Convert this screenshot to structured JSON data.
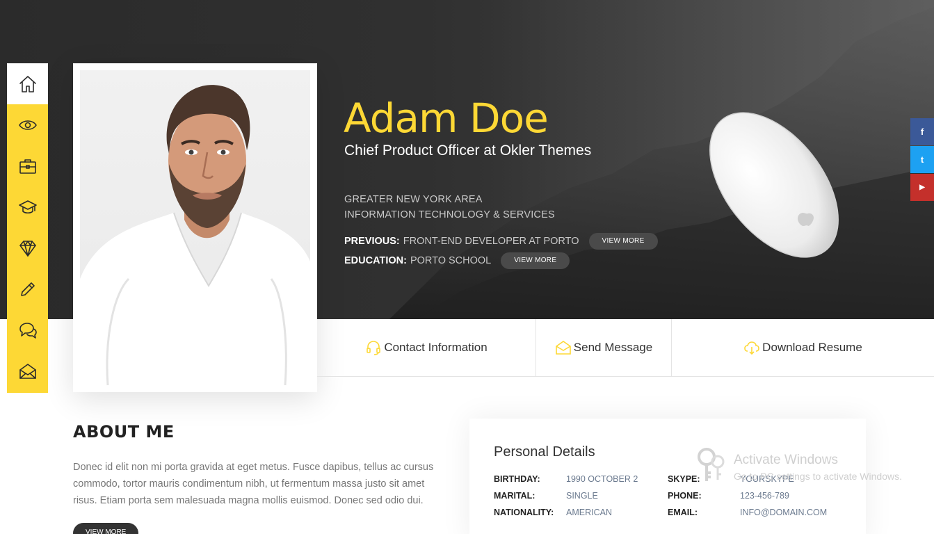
{
  "profile": {
    "name": "Adam Doe",
    "title": "Chief Product Officer at Okler Themes",
    "location": "GREATER NEW YORK AREA",
    "industry": "INFORMATION TECHNOLOGY & SERVICES",
    "previous_label": "PREVIOUS:",
    "previous_value": "FRONT-END DEVELOPER AT PORTO",
    "education_label": "EDUCATION:",
    "education_value": "PORTO SCHOOL",
    "view_more": "VIEW MORE"
  },
  "sidebar": {
    "items": [
      {
        "icon": "home-icon"
      },
      {
        "icon": "eye-icon"
      },
      {
        "icon": "briefcase-icon"
      },
      {
        "icon": "graduation-cap-icon"
      },
      {
        "icon": "diamond-icon"
      },
      {
        "icon": "pencil-icon"
      },
      {
        "icon": "chat-icon"
      },
      {
        "icon": "envelope-icon"
      }
    ],
    "active_color": "#ffffff",
    "background": "#fdd835"
  },
  "social": [
    {
      "icon": "facebook-icon",
      "glyph": "f",
      "color": "#3b5998"
    },
    {
      "icon": "twitter-icon",
      "glyph": "t",
      "color": "#1da1f2"
    },
    {
      "icon": "youtube-icon",
      "glyph": "▶",
      "color": "#c4302b"
    }
  ],
  "actions": {
    "contact": "Contact Information",
    "message": "Send Message",
    "resume": "Download Resume"
  },
  "about": {
    "title": "ABOUT ME",
    "text": "Donec id elit non mi porta gravida at eget metus. Fusce dapibus, tellus ac cursus commodo, tortor mauris condimentum nibh, ut fermentum massa justo sit amet risus. Etiam porta sem malesuada magna mollis euismod. Donec sed odio dui.",
    "button": "VIEW MORE"
  },
  "details": {
    "title": "Personal Details",
    "rows": [
      {
        "label": "BIRTHDAY:",
        "value": "1990 OCTOBER 2"
      },
      {
        "label": "MARITAL:",
        "value": "SINGLE"
      },
      {
        "label": "NATIONALITY:",
        "value": "AMERICAN"
      },
      {
        "label": "SKYPE:",
        "value": "YOURSKYPE"
      },
      {
        "label": "PHONE:",
        "value": "123-456-789"
      },
      {
        "label": "EMAIL:",
        "value": "INFO@DOMAIN.COM"
      }
    ]
  },
  "watermark": {
    "title": "Activate Windows",
    "subtitle": "Go to PC settings to activate Windows."
  },
  "colors": {
    "accent": "#fdd835",
    "hero_bg": "#2f2f2f"
  }
}
